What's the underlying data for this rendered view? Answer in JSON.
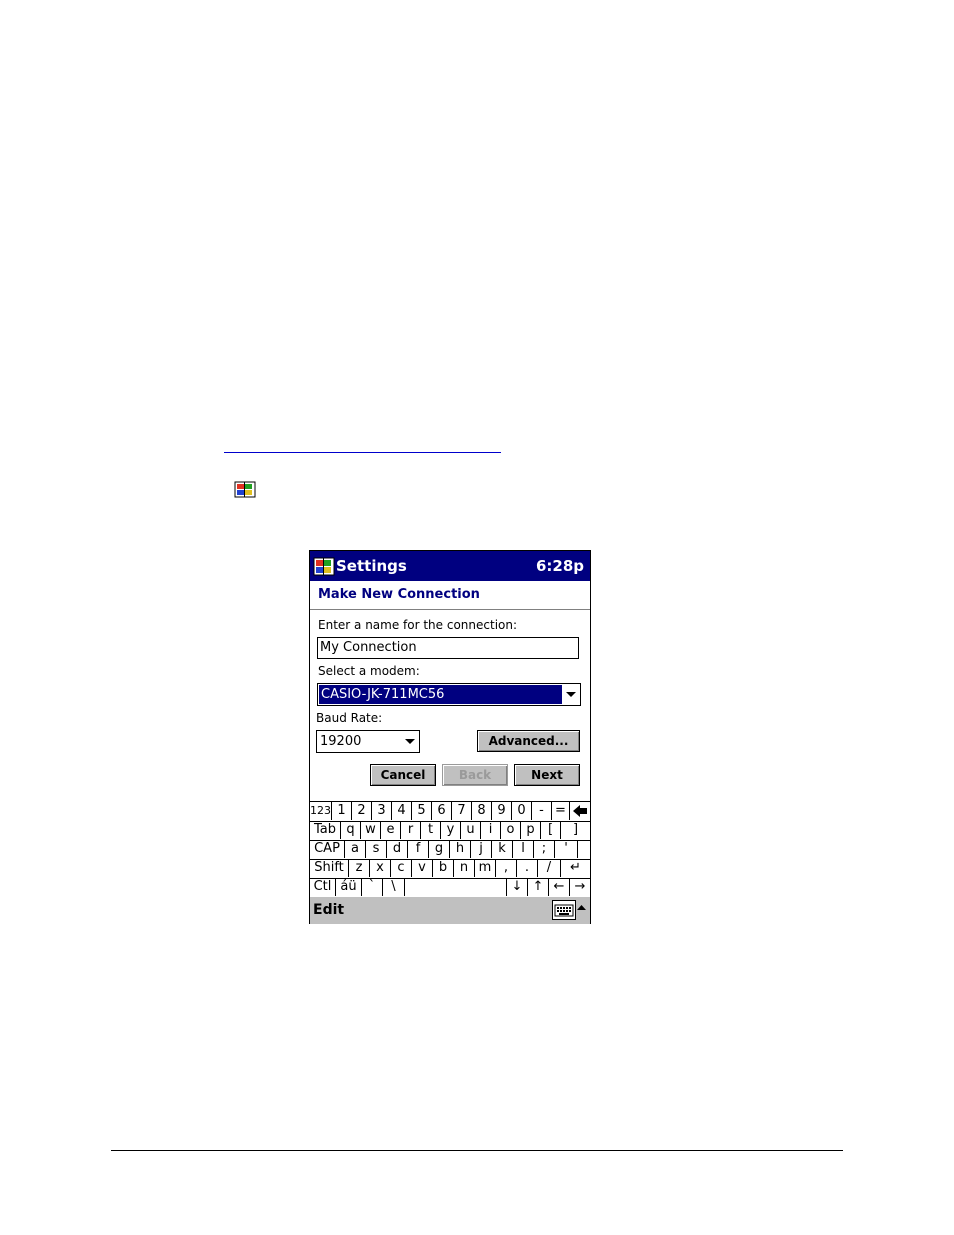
{
  "window": {
    "title": "Settings",
    "clock": "6:28p"
  },
  "page": {
    "heading": "Make New Connection"
  },
  "form": {
    "name_label": "Enter a name for the connection:",
    "name_value": "My Connection",
    "modem_label": "Select a modem:",
    "modem_value": "CASIO-JK-711MC56",
    "baud_label": "Baud Rate:",
    "baud_value": "19200",
    "advanced_label": "Advanced..."
  },
  "buttons": {
    "cancel": "Cancel",
    "back": "Back",
    "next": "Next"
  },
  "keyboard": {
    "row1": [
      "123",
      "1",
      "2",
      "3",
      "4",
      "5",
      "6",
      "7",
      "8",
      "9",
      "0",
      "-",
      "=",
      "◆"
    ],
    "row2": [
      "Tab",
      "q",
      "w",
      "e",
      "r",
      "t",
      "y",
      "u",
      "i",
      "o",
      "p",
      "[",
      "]"
    ],
    "row3": [
      "CAP",
      "a",
      "s",
      "d",
      "f",
      "g",
      "h",
      "j",
      "k",
      "l",
      ";",
      "'"
    ],
    "row4": [
      "Shift",
      "z",
      "x",
      "c",
      "v",
      "b",
      "n",
      "m",
      ",",
      ".",
      "/",
      "↵"
    ],
    "row5": [
      "Ctl",
      "áü",
      "`",
      "\\",
      "",
      "↓",
      "↑",
      "←",
      "→"
    ]
  },
  "menubar": {
    "edit": "Edit"
  },
  "icons": {
    "start_logo": "windows-flag-icon",
    "keyboard": "keyboard-icon",
    "sip_arrow": "arrow-up-icon"
  },
  "colors": {
    "titlebar": "#000080",
    "heading": "#000080",
    "selection": "#000080",
    "button_face": "#c0c0c0"
  }
}
